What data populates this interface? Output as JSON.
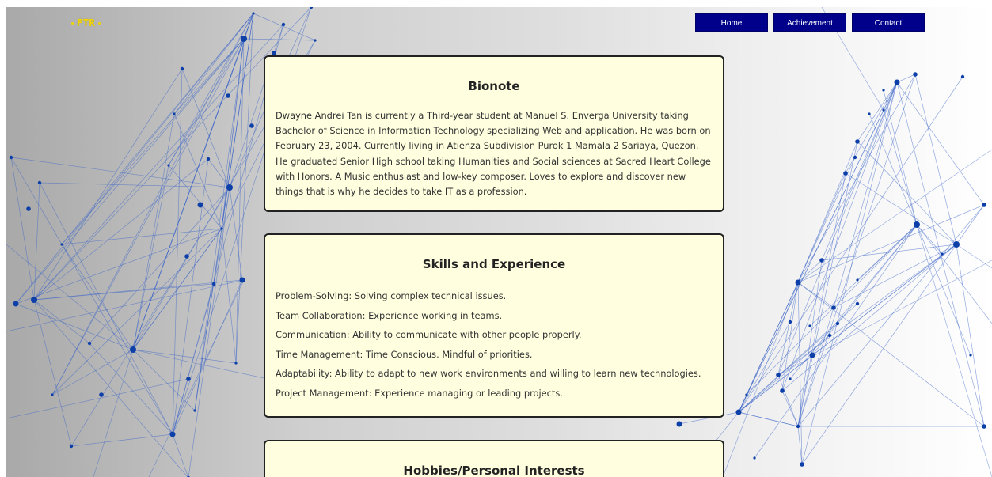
{
  "logo": {
    "text": "FTR"
  },
  "nav": {
    "items": [
      "Home",
      "Achievement",
      "Contact"
    ]
  },
  "bionote": {
    "title": "Bionote",
    "text": "Dwayne Andrei Tan is currently a Third-year student at Manuel S. Enverga University taking Bachelor of Science in Information Technology specializing Web and application. He was born on February 23, 2004. Currently living in Atienza Subdivision Purok 1 Mamala 2 Sariaya, Quezon. He graduated Senior High school taking Humanities and Social sciences at Sacred Heart College with Honors. A Music enthusiast and low-key composer. Loves to explore and discover new things that is why he decides to take IT as a profession."
  },
  "skills": {
    "title": "Skills and Experience",
    "items": [
      "Problem-Solving: Solving complex technical issues.",
      "Team Collaboration: Experience working in teams.",
      "Communication: Ability to communicate with other people properly.",
      "Time Management: Time Conscious. Mindful of priorities.",
      "Adaptability: Ability to adapt to new work environments and willing to learn new technologies.",
      "Project Management: Experience managing or leading projects."
    ]
  },
  "hobbies": {
    "title": "Hobbies/Personal Interests"
  },
  "colors": {
    "nav_bg": "#00008b",
    "card_bg": "#ffffe0",
    "network_line": "#3a64c8",
    "network_node": "#0d3fa8",
    "logo": "#f4d600"
  }
}
